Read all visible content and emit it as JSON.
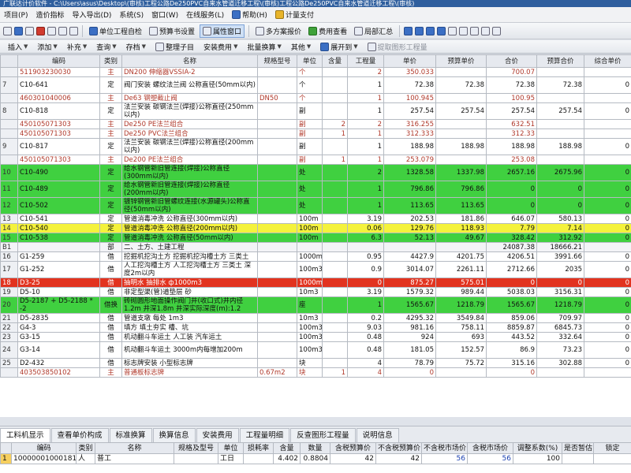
{
  "window": {
    "title": "广联达计价软件 - C:\\Users\\asus\\Desktop\\(审核)工程公路De250PVC自来水管道迁移工程\\(审核)工程公路De250PVC自来水管道迁移工程\\(审核)"
  },
  "menu": [
    "项目(P)",
    "造价指标",
    "导入导出(D)",
    "系统(S)",
    "窗口(W)",
    "在线服务(L)",
    "帮助(H)",
    "计量支付"
  ],
  "toolbar": {
    "unit_project": "单位工程自检",
    "budget_settings": "预算书设置",
    "attr_window": "属性窗口",
    "multi_report": "多方案报价",
    "fee_view": "费用查看",
    "local_summary": "局部汇总"
  },
  "toolbar2": [
    "插入",
    "添加",
    "补充",
    "查询",
    "存档",
    "整理子目",
    "安装费用",
    "批量换算",
    "其他",
    "展开到",
    "提取图形工程量"
  ],
  "columns": [
    "编码",
    "类别",
    "名称",
    "规格型号",
    "单位",
    "含量",
    "工程量",
    "单价",
    "预算单价",
    "合价",
    "预算合价",
    "综合单价"
  ],
  "rows": [
    {
      "rn": "",
      "code": "511903230030",
      "cat": "主",
      "name": "DN200 伸缩器VSSIA-2",
      "spec": "",
      "unit": "个",
      "qty_ratio": "",
      "qty": "2",
      "price": "350.033",
      "bprice": "",
      "total": "700.07",
      "btotal": "",
      "comp": "",
      "style": "sub"
    },
    {
      "rn": "7",
      "code": "C10-641",
      "cat": "定",
      "name": "阀门安装 螺纹法兰阀 公称直径(50mm以内)",
      "spec": "",
      "unit": "个",
      "qty_ratio": "",
      "qty": "1",
      "price": "72.38",
      "bprice": "72.38",
      "total": "72.38",
      "btotal": "72.38",
      "comp": "0",
      "style": ""
    },
    {
      "rn": "",
      "code": "460301040006",
      "cat": "主",
      "name": "De63 钢塑截止阀",
      "spec": "DN50",
      "unit": "个",
      "qty_ratio": "",
      "qty": "1",
      "price": "100.945",
      "bprice": "",
      "total": "100.95",
      "btotal": "",
      "comp": "",
      "style": "sub"
    },
    {
      "rn": "8",
      "code": "C10-818",
      "cat": "定",
      "name": "法兰安装 碳钢法兰(焊接)公称直径(250mm以内)",
      "spec": "",
      "unit": "副",
      "qty_ratio": "",
      "qty": "1",
      "price": "257.54",
      "bprice": "257.54",
      "total": "257.54",
      "btotal": "257.54",
      "comp": "0",
      "style": ""
    },
    {
      "rn": "",
      "code": "450105071303",
      "cat": "主",
      "name": "De250 PE法兰组合",
      "spec": "",
      "unit": "副",
      "qty_ratio": "2",
      "qty": "2",
      "price": "316.255",
      "bprice": "",
      "total": "632.51",
      "btotal": "",
      "comp": "",
      "style": "sub"
    },
    {
      "rn": "",
      "code": "450105071303",
      "cat": "主",
      "name": "De250 PVC法兰组合",
      "spec": "",
      "unit": "副",
      "qty_ratio": "1",
      "qty": "1",
      "price": "312.333",
      "bprice": "",
      "total": "312.33",
      "btotal": "",
      "comp": "",
      "style": "sub"
    },
    {
      "rn": "9",
      "code": "C10-817",
      "cat": "定",
      "name": "法兰安装 碳钢法兰(焊接)公称直径(200mm以内)",
      "spec": "",
      "unit": "副",
      "qty_ratio": "",
      "qty": "1",
      "price": "188.98",
      "bprice": "188.98",
      "total": "188.98",
      "btotal": "188.98",
      "comp": "0",
      "style": ""
    },
    {
      "rn": "",
      "code": "450105071303",
      "cat": "主",
      "name": "De200 PE法兰组合",
      "spec": "",
      "unit": "副",
      "qty_ratio": "1",
      "qty": "1",
      "price": "253.079",
      "bprice": "",
      "total": "253.08",
      "btotal": "",
      "comp": "",
      "style": "sub"
    },
    {
      "rn": "10",
      "code": "C10-490",
      "cat": "定",
      "name": "给水钢管新旧管连接(焊接)公称直径(300mm以内)",
      "spec": "",
      "unit": "处",
      "qty_ratio": "",
      "qty": "2",
      "price": "1328.58",
      "bprice": "1337.98",
      "total": "2657.16",
      "btotal": "2675.96",
      "comp": "0",
      "style": "green"
    },
    {
      "rn": "11",
      "code": "C10-489",
      "cat": "定",
      "name": "给水钢管新旧管连接(焊接)公称直径(200mm以内)",
      "spec": "",
      "unit": "处",
      "qty_ratio": "",
      "qty": "1",
      "price": "796.86",
      "bprice": "796.86",
      "total": "0",
      "btotal": "0",
      "comp": "0",
      "style": "green"
    },
    {
      "rn": "12",
      "code": "C10-502",
      "cat": "定",
      "name": "镀锌钢管新旧管螺纹连接(水源罐头)公称直径(50mm以内)",
      "spec": "",
      "unit": "处",
      "qty_ratio": "",
      "qty": "1",
      "price": "113.65",
      "bprice": "113.65",
      "total": "0",
      "btotal": "0",
      "comp": "0",
      "style": "green"
    },
    {
      "rn": "13",
      "code": "C10-541",
      "cat": "定",
      "name": "管道消毒冲洗 公称直径(300mm以内)",
      "spec": "",
      "unit": "100m",
      "qty_ratio": "",
      "qty": "3.19",
      "price": "202.53",
      "bprice": "181.86",
      "total": "646.07",
      "btotal": "580.13",
      "comp": "0",
      "style": ""
    },
    {
      "rn": "14",
      "code": "C10-540",
      "cat": "定",
      "name": "管道消毒冲洗 公称直径(200mm以内)",
      "spec": "",
      "unit": "100m",
      "qty_ratio": "",
      "qty": "0.06",
      "price": "129.76",
      "bprice": "118.93",
      "total": "7.79",
      "btotal": "7.14",
      "comp": "0",
      "style": "yellow"
    },
    {
      "rn": "15",
      "code": "C10-538",
      "cat": "定",
      "name": "管道消毒冲洗 公称直径(50mm以内)",
      "spec": "",
      "unit": "100m",
      "qty_ratio": "",
      "qty": "6.3",
      "price": "52.13",
      "bprice": "49.67",
      "total": "328.42",
      "btotal": "312.92",
      "comp": "0",
      "style": "green"
    },
    {
      "rn": "B1",
      "code": "",
      "cat": "部",
      "name": "二、土方、土建工程",
      "spec": "",
      "unit": "",
      "qty_ratio": "",
      "qty": "",
      "price": "",
      "bprice": "",
      "total": "24087.38",
      "btotal": "18666.21",
      "comp": "",
      "style": "bold"
    },
    {
      "rn": "16",
      "code": "G1-259",
      "cat": "借",
      "name": "挖掘机挖沟土方 挖掘机挖沟槽土方 三类土",
      "spec": "",
      "unit": "1000m3",
      "qty_ratio": "",
      "qty": "0.95",
      "price": "4427.9",
      "bprice": "4201.75",
      "total": "4206.51",
      "btotal": "3991.66",
      "comp": "0",
      "style": ""
    },
    {
      "rn": "17",
      "code": "G1-252",
      "cat": "借",
      "name": "人工挖沟槽土方 人工挖沟槽土方 三类土 深度2m以内",
      "spec": "",
      "unit": "100m3",
      "qty_ratio": "",
      "qty": "0.9",
      "price": "3014.07",
      "bprice": "2261.11",
      "total": "2712.66",
      "btotal": "2035",
      "comp": "0",
      "style": ""
    },
    {
      "rn": "18",
      "code": "D3-25",
      "cat": "借",
      "name": "抽明水 抽排水 ф1000m3",
      "spec": "",
      "unit": "1000m3",
      "qty_ratio": "",
      "qty": "0",
      "price": "875.27",
      "bprice": "575.01",
      "total": "0",
      "btotal": "0",
      "comp": "0",
      "style": "red"
    },
    {
      "rn": "19",
      "code": "D5-10",
      "cat": "借",
      "name": "非定型渠(管)道垫层 砂",
      "spec": "",
      "unit": "10m3",
      "qty_ratio": "",
      "qty": "3.19",
      "price": "1579.32",
      "bprice": "989.44",
      "total": "5038.03",
      "btotal": "3156.31",
      "comp": "0",
      "style": ""
    },
    {
      "rn": "20",
      "code": "D5-2187 + D5-2188 * -2",
      "cat": "借换",
      "name": "砖砌圆形地面操作阀门井(收口式)井内径1.2m 井深1.8m 井深实际深度(m):1.2",
      "spec": "",
      "unit": "座",
      "qty_ratio": "",
      "qty": "1",
      "price": "1565.67",
      "bprice": "1218.79",
      "total": "1565.67",
      "btotal": "1218.79",
      "comp": "0",
      "style": "green"
    },
    {
      "rn": "21",
      "code": "D5-2835",
      "cat": "借",
      "name": "管道支墩 每处 1m3",
      "spec": "",
      "unit": "10m3",
      "qty_ratio": "",
      "qty": "0.2",
      "price": "4295.32",
      "bprice": "3549.84",
      "total": "859.06",
      "btotal": "709.97",
      "comp": "0",
      "style": ""
    },
    {
      "rn": "22",
      "code": "G4-3",
      "cat": "借",
      "name": "填方 填土夯实 槽、坑",
      "spec": "",
      "unit": "100m3",
      "qty_ratio": "",
      "qty": "9.03",
      "price": "981.16",
      "bprice": "758.11",
      "total": "8859.87",
      "btotal": "6845.73",
      "comp": "0",
      "style": ""
    },
    {
      "rn": "23",
      "code": "G3-15",
      "cat": "借",
      "name": "机动翻斗车运土 人工装 汽车运土",
      "spec": "",
      "unit": "100m3",
      "qty_ratio": "",
      "qty": "0.48",
      "price": "924",
      "bprice": "693",
      "total": "443.52",
      "btotal": "332.64",
      "comp": "0",
      "style": ""
    },
    {
      "rn": "24",
      "code": "G3-14",
      "cat": "借",
      "name": "机动翻斗车运土 3000m内每增加200m",
      "spec": "",
      "unit": "100m3",
      "qty_ratio": "",
      "qty": "0.48",
      "price": "181.05",
      "bprice": "152.57",
      "total": "86.9",
      "btotal": "73.23",
      "comp": "0",
      "style": ""
    },
    {
      "rn": "25",
      "code": "D2-432",
      "cat": "借",
      "name": "标志牌安装 小型标志牌",
      "spec": "",
      "unit": "块",
      "qty_ratio": "",
      "qty": "4",
      "price": "78.79",
      "bprice": "75.72",
      "total": "315.16",
      "btotal": "302.88",
      "comp": "0",
      "style": ""
    },
    {
      "rn": "",
      "code": "403503850102",
      "cat": "主",
      "name": "普通板标志牌",
      "spec": "0.67m2",
      "unit": "块",
      "qty_ratio": "1",
      "qty": "4",
      "price": "0",
      "bprice": "",
      "total": "0",
      "btotal": "",
      "comp": "",
      "style": "sub"
    }
  ],
  "tabs": [
    "工料机显示",
    "查看单价构成",
    "标准换算",
    "换算信息",
    "安装费用",
    "工程量明细",
    "反查图形工程量",
    "说明信息"
  ],
  "bottom": {
    "columns": [
      "编码",
      "类别",
      "名称",
      "规格及型号",
      "单位",
      "损耗率",
      "含量",
      "数量",
      "含税预算价",
      "不含税预算价",
      "不含税市场价",
      "含税市场价",
      "调整系数(%)",
      "是否暂估",
      "锁定"
    ],
    "row": {
      "rn": "1",
      "code": "10000001000181",
      "cat": "人",
      "name": "普工",
      "spec": "",
      "unit": "工日",
      "loss": "",
      "ratio": "4.402",
      "num": "0.8804",
      "p1": "42",
      "p2": "42",
      "p3": "56",
      "p4": "56",
      "adj": "100",
      "est": "",
      "lock": ""
    }
  }
}
